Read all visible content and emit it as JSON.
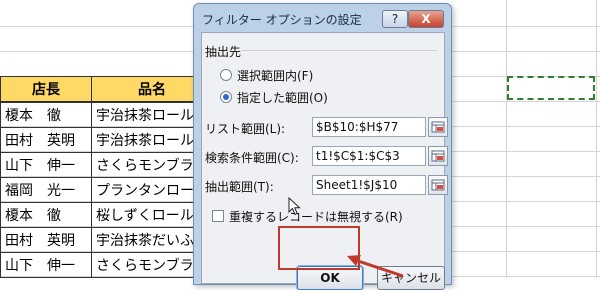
{
  "sheet": {
    "headers": [
      "店長",
      "品名"
    ],
    "rows": [
      [
        "榎本　徹",
        "宇治抹茶ロール"
      ],
      [
        "田村　英明",
        "宇治抹茶ロール"
      ],
      [
        "山下　伸一",
        "さくらモンブラン"
      ],
      [
        "福岡　光一",
        "プランタンロール"
      ],
      [
        "榎本　徹",
        "桜しずくロール"
      ],
      [
        "田村　英明",
        "宇治抹茶だいふく"
      ],
      [
        "山下　伸一",
        "さくらモンブラン"
      ]
    ],
    "header_color": "#ffd966"
  },
  "dialog": {
    "title": "フィルター オプションの設定",
    "help_label": "?",
    "close_label": "X",
    "section_label": "抽出先",
    "radio_in_place": "選択範囲内(F)",
    "radio_copy": "指定した範囲(O)",
    "list_range_label": "リスト範囲(L):",
    "list_range_value": "$B$10:$H$77",
    "criteria_range_label": "検索条件範囲(C):",
    "criteria_range_value": "t1!$C$1:$C$3",
    "copy_to_label": "抽出範囲(T):",
    "copy_to_value": "Sheet1!$J$10",
    "unique_label": "重複するレコードは無視する(R)",
    "ok_label": "OK",
    "cancel_label": "キャンセル",
    "selected_radio": "copy",
    "unique_checked": false
  },
  "annotation_color": "#c0392b",
  "marquee_color": "#2e7d32"
}
